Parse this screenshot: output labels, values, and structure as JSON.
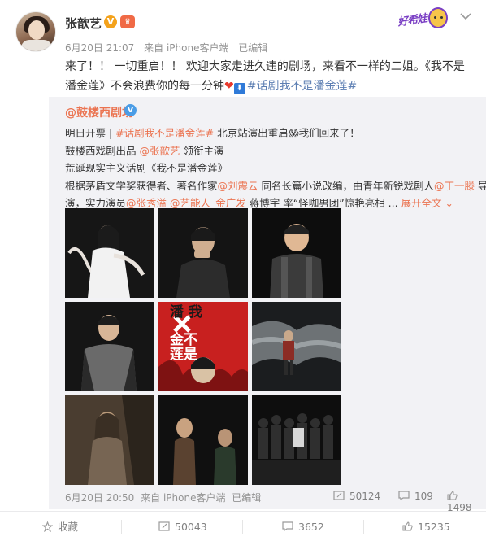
{
  "post": {
    "author": "张歆艺",
    "verified_badge": "V",
    "vip_badge": "♛",
    "time": "6月20日 21:07",
    "source": "来自 iPhone客户端",
    "edited": "已编辑",
    "text_part1": "来了！！ 一切重启！！ 欢迎大家走进久违的剧场，来看不一样的二姐。《我不是潘金莲》不会浪费你的每一分钟",
    "heart": "❤",
    "arrow": "⬇",
    "topic": "#话剧我不是潘金莲#"
  },
  "badge": {
    "label": "好希娃"
  },
  "retweet": {
    "author": "@鼓楼西剧场",
    "line1_a": "明日开票 | ",
    "line1_topic": "#话剧我不是潘金莲#",
    "line1_b": " 北京站演出重启",
    "line1_emoji": "😱",
    "line1_c": "我们回来了！",
    "line2_a": "鼓楼西戏剧出品 ",
    "line2_mention": "@张歆艺",
    "line2_b": " 领衔主演",
    "line3": "荒诞现实主义话剧《我不是潘金莲》",
    "line4_a": "根据茅盾文学奖获得者、著名作家",
    "line4_mention": "@刘震云",
    "line4_b": " 同名长篇小说改编，由青年新锐戏剧人",
    "line4_mention2": "@丁一滕",
    "line4_c": " 导",
    "line5_a": "演，实力演员",
    "line5_mention": "@张秀溢",
    "line5_mention2": "@艺能人_金广发",
    "line5_b": " 蒋博宇 率“怪咖男团”惊艳亮相 ... ",
    "expand": "展开全文 ⌄",
    "poster_title_a": "我",
    "poster_title_b": "不",
    "poster_title_c": "是",
    "poster_title_d": "潘",
    "poster_title_e": "金",
    "poster_title_f": "莲",
    "footer": {
      "time": "6月20日 20:50",
      "source": "来自 iPhone客户端",
      "edited": "已编辑",
      "reposts": "50124",
      "comments": "109",
      "likes": "1498"
    }
  },
  "actions": {
    "favorite": "收藏",
    "repost": "50043",
    "comment": "3652",
    "like": "15235"
  },
  "colors": {
    "accent": "#eb7350",
    "meta": "#939393",
    "retweet_bg": "#f2f2f5",
    "poster_red": "#c8201f"
  },
  "icons": {
    "favorite": "star-icon",
    "repost": "repost-icon",
    "comment": "comment-icon",
    "like": "thumbs-up-icon",
    "dropdown": "chevron-down-icon"
  }
}
